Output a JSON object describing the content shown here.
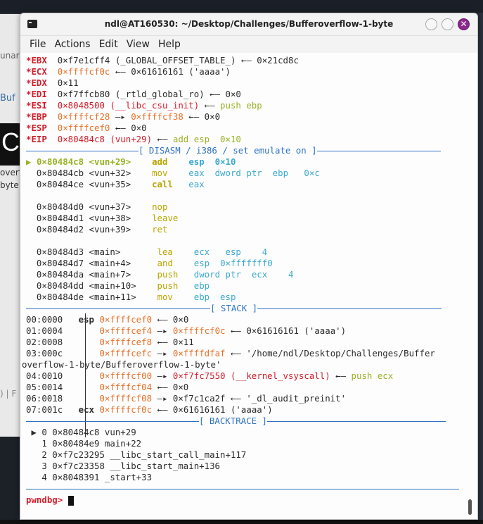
{
  "background": {
    "partial_text_1": "unar",
    "partial_text_2": "Buf",
    "partial_text_3": "overf",
    "partial_text_4": "byte.",
    "partial_text_5": ") | F",
    "partial_big": "C"
  },
  "window": {
    "title": "ndl@AT160530: ~/Desktop/Challenges/Bufferoverflow-1-byte",
    "close_glyph": "✕"
  },
  "menu": [
    "File",
    "Actions",
    "Edit",
    "View",
    "Help"
  ],
  "registers": [
    {
      "name": "*EBX",
      "value": "0×f7e1cff4",
      "rest": " (_GLOBAL_OFFSET_TABLE_) ←— 0×21cd8c"
    },
    {
      "name": "*ECX",
      "value": "0×ffffcf0c",
      "rest": " ←— 0×61616161 ('aaaa')"
    },
    {
      "name": "*EDX",
      "value": "0×11",
      "rest": ""
    },
    {
      "name": "*EDI",
      "value": "0×f7ffcb80",
      "rest": " (_rtld_global_ro) ←— 0×0"
    },
    {
      "name": "*ESI",
      "value": "0×8048500",
      "rest_red": " (__libc_csu_init)",
      "arrow": " ←— ",
      "rest_green": "push ebp"
    },
    {
      "name": "*EBP",
      "value": "0×ffffcf28",
      "arrow": " —▸ ",
      "value2": "0×ffffcf38",
      "rest": " ←— 0×0"
    },
    {
      "name": "*ESP",
      "value": "0×ffffcef0",
      "rest": " ←— 0×0"
    },
    {
      "name": "*EIP",
      "value": "0×80484c8",
      "rest_red": " (vun+29)",
      "arrow": " ←— ",
      "rest_green": "add esp  0×10"
    }
  ],
  "disasm_header": "[ DISASM / i386 / set emulate on ]",
  "disasm": [
    {
      "marker": "▶",
      "addr": "0×80484c8",
      "sym": "<vun+29>",
      "op": "add",
      "args": "esp  0×10",
      "current": true
    },
    {
      "marker": "",
      "addr": "0×80484cb",
      "sym": "<vun+32>",
      "op": "mov",
      "args": "eax  dword ptr  ebp   0×c"
    },
    {
      "marker": "",
      "addr": "0×80484ce",
      "sym": "<vun+35>",
      "op": "call",
      "args": "eax",
      "bold_op": true
    },
    {
      "marker": "",
      "addr": "",
      "sym": "",
      "op": "",
      "args": ""
    },
    {
      "marker": "",
      "addr": "0×80484d0",
      "sym": "<vun+37>",
      "op": "nop",
      "args": ""
    },
    {
      "marker": "",
      "addr": "0×80484d1",
      "sym": "<vun+38>",
      "op": "leave",
      "args": ""
    },
    {
      "marker": "",
      "addr": "0×80484d2",
      "sym": "<vun+39>",
      "op": "ret",
      "args": ""
    },
    {
      "marker": "",
      "addr": "",
      "sym": "",
      "op": "",
      "args": ""
    },
    {
      "marker": "",
      "addr": "0×80484d3",
      "sym": "<main>",
      "op": "lea",
      "args": "ecx   esp    4"
    },
    {
      "marker": "",
      "addr": "0×80484d7",
      "sym": "<main+4>",
      "op": "and",
      "args": "esp  0×fffffff0"
    },
    {
      "marker": "",
      "addr": "0×80484da",
      "sym": "<main+7>",
      "op": "push",
      "args": "dword ptr  ecx    4"
    },
    {
      "marker": "",
      "addr": "0×80484dd",
      "sym": "<main+10>",
      "op": "push",
      "args": "ebp"
    },
    {
      "marker": "",
      "addr": "0×80484de",
      "sym": "<main+11>",
      "op": "mov",
      "args": "ebp  esp"
    }
  ],
  "stack_header": "[ STACK ]",
  "stack": [
    {
      "idx": "00:0000",
      "reg": "esp",
      "addr": "0×ffffcef0",
      "rest": " ←— 0×0"
    },
    {
      "idx": "01:0004",
      "reg": "",
      "addr": "0×ffffcef4",
      "arrow": " —▸ ",
      "addr2": "0×ffffcf0c",
      "rest": " ←— 0×61616161 ('aaaa')"
    },
    {
      "idx": "02:0008",
      "reg": "",
      "addr": "0×ffffcef8",
      "rest": " ←— 0×11"
    },
    {
      "idx": "03:000c",
      "reg": "",
      "addr": "0×ffffcefc",
      "arrow": " —▸ ",
      "addr2": "0×ffffdfaf",
      "rest": " ←— '/home/ndl/Desktop/Challenges/Buffer"
    },
    {
      "idx": "",
      "wrap": "overflow-1-byte/Bufferoverflow-1-byte'"
    },
    {
      "idx": "04:0010",
      "reg": "",
      "addr": "0×ffffcf00",
      "arrow": " —▸ ",
      "addr_red": "0×f7fc7550 (__kernel_vsyscall)",
      "arrow2": " ←— ",
      "green": "push ecx"
    },
    {
      "idx": "05:0014",
      "reg": "",
      "addr": "0×ffffcf04",
      "rest": " ←— 0×0"
    },
    {
      "idx": "06:0018",
      "reg": "",
      "addr": "0×ffffcf08",
      "arrow": " —▸ ",
      "rest": "0×f7c1ca2f ←— '_dl_audit_preinit'"
    },
    {
      "idx": "07:001c",
      "reg": "ecx",
      "addr": "0×ffffcf0c",
      "rest": " ←— 0×61616161 ('aaaa')"
    }
  ],
  "backtrace_header": "[ BACKTRACE ]",
  "backtrace": [
    "▶ 0 0×80484c8 vun+29",
    "  1 0×80484e9 main+22",
    "  2 0×f7c23295 __libc_start_call_main+117",
    "  3 0×f7c23358 __libc_start_main+136",
    "  4 0×8048391 _start+33"
  ],
  "prompt": "pwndbg>"
}
